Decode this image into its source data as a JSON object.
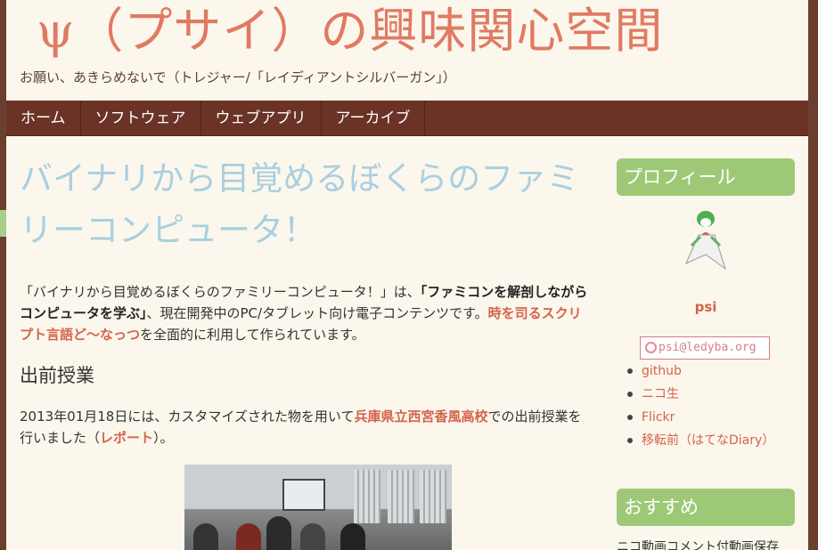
{
  "header": {
    "title": "ψ（プサイ）の興味関心空間",
    "tagline": "お願い、あきらめないで（トレジャー/「レイディアントシルバーガン」）"
  },
  "nav": {
    "items": [
      {
        "label": "ホーム"
      },
      {
        "label": "ソフトウェア"
      },
      {
        "label": "ウェブアプリ"
      },
      {
        "label": "アーカイブ"
      }
    ]
  },
  "post": {
    "title": "バイナリから目覚めるぼくらのファミリーコンピュータ！",
    "intro": {
      "t1": "「バイナリから目覚めるぼくらのファミリーコンピュータ！」は、",
      "t2": "「ファミコンを解剖しながらコンピュータを学ぶ」",
      "t3": "、現在開発中のPC/タブレット向け電子コンテンツです。",
      "link": "時を司るスクリプト言語ど〜なっつ",
      "t4": "を全面的に利用して作られています。"
    },
    "section_heading": "出前授業",
    "section": {
      "t1": "2013年01月18日には、カスタマイズされた物を用いて",
      "link1": "兵庫県立西宮香風高校",
      "t2": "での出前授業を行いました（",
      "link2": "レポート",
      "t3": "）。"
    }
  },
  "sidebar": {
    "profile_title": "プロフィール",
    "name": "psi",
    "email": "psi@ledyba.org",
    "links": [
      "github",
      "ニコ生",
      "Flickr",
      "移転前（はてなDiary）"
    ],
    "recommend_title": "おすすめ",
    "recommend_text": "ニコ動画コメント付動画保存"
  },
  "colors": {
    "accent": "#e07a62",
    "nav_bg": "#6b3325",
    "widget_bg": "#9dc977",
    "post_title": "#a9cfe0",
    "link": "#d4634c"
  }
}
